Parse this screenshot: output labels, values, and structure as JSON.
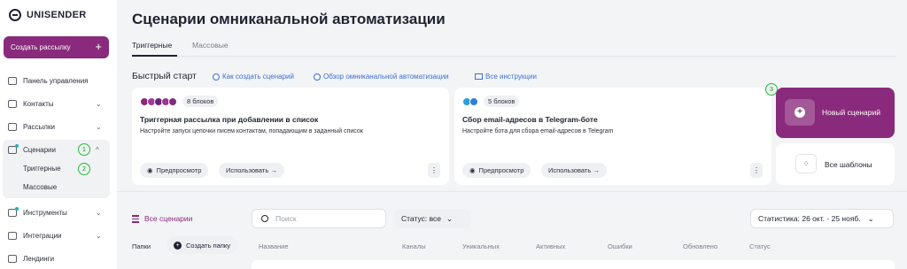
{
  "brand": {
    "name": "UNISENDER"
  },
  "sidebar": {
    "create_label": "Создать рассылку",
    "create_plus": "+",
    "items": [
      {
        "label": "Панель управления",
        "icon": "home-icon"
      },
      {
        "label": "Контакты",
        "icon": "contacts-icon",
        "chev": "⌄"
      },
      {
        "label": "Рассылки",
        "icon": "mail-icon",
        "chev": "⌄"
      },
      {
        "label": "Сценарии",
        "icon": "scenario-icon",
        "chev": "^"
      },
      {
        "label": "Инструменты",
        "icon": "tools-icon",
        "chev": "⌄"
      },
      {
        "label": "Интеграции",
        "icon": "integrations-icon",
        "chev": "⌄"
      },
      {
        "label": "Лендинги",
        "icon": "landing-icon"
      }
    ],
    "sub_items": [
      "Триггерные",
      "Массовые"
    ],
    "steps": [
      "1",
      "2",
      "3"
    ]
  },
  "page": {
    "title": "Сценарии омниканальной автоматизации",
    "tabs": [
      "Триггерные",
      "Массовые"
    ]
  },
  "quick_start": {
    "title": "Быстрый старт",
    "links": [
      "Как создать сценарий",
      "Обзор омниканальной автоматизации",
      "Все инструкции"
    ],
    "cards": [
      {
        "blocks": "8 блоков",
        "title": "Триггерная рассылка при добавлении в список",
        "desc": "Настройте запуск цепочки писем контактам, попадающим в заданный список",
        "preview": "Предпросмотр",
        "use": "Использовать →",
        "more": "⋮"
      },
      {
        "blocks": "5 блоков",
        "title": "Сбор email-адресов в Telegram-боте",
        "desc": "Настройте бота для сбора email-адресов в Telegram",
        "preview": "Предпросмотр",
        "use": "Использовать →",
        "more": "⋮"
      }
    ],
    "new_scenario": "Новый сценарий",
    "all_templates": "Все шаблоны"
  },
  "list": {
    "all_scenarios": "Все сценарии",
    "search_placeholder": "Поиск",
    "status_filter": "Статус: все",
    "stats_range": "Статистика: 26 окт. - 25 нояб.",
    "folders_label": "Папки",
    "create_folder": "Создать папку",
    "columns": [
      "Название",
      "Каналы",
      "Уникальных",
      "Активных",
      "Ошибки",
      "Обновлено",
      "Статус"
    ]
  },
  "colors": {
    "brand": "#8a2a7c",
    "link": "#3e6fd8",
    "step_green": "#2fb24c"
  }
}
